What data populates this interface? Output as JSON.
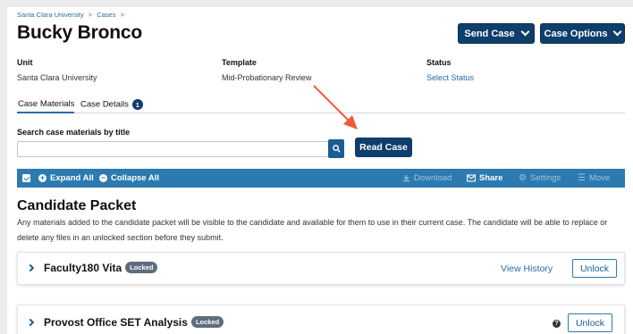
{
  "breadcrumb": [
    "Santa Clara University",
    ">",
    "Cases",
    ">"
  ],
  "header": {
    "title": "Bucky Bronco",
    "send_case": "Send Case",
    "case_options": "Case Options"
  },
  "meta": {
    "unit_label": "Unit",
    "unit_value": "Santa Clara University",
    "template_label": "Template",
    "template_value": "Mid-Probationary Review",
    "status_label": "Status",
    "status_value": "Select Status"
  },
  "tabs": [
    {
      "label": "Case Materials"
    },
    {
      "label": "Case Details",
      "badge": "1"
    }
  ],
  "search": {
    "label": "Search case materials by title",
    "value": "",
    "placeholder": ""
  },
  "read_case": "Read Case",
  "toolbar": {
    "expand_all": "Expand All",
    "collapse_all": "Collapse All",
    "download": "Download",
    "share": "Share",
    "settings": "Settings",
    "move": "Move"
  },
  "packet": {
    "title": "Candidate Packet",
    "description": "Any materials added to the candidate packet will be visible to the candidate and available for them to use in their current case. The candidate will be able to replace or delete any files in an unlocked section before they submit."
  },
  "sections": [
    {
      "title": "Faculty180 Vita",
      "badge": "Locked",
      "view_history": "View History",
      "unlock": "Unlock"
    },
    {
      "title": "Provost Office SET Analysis",
      "badge": "Locked",
      "unlock": "Unlock"
    }
  ],
  "colors": {
    "primary_dark": "#0e3e6b",
    "toolbar_blue": "#2c7ab0",
    "link_blue": "#2a6ca8",
    "annotation_arrow": "#f05a3a"
  }
}
